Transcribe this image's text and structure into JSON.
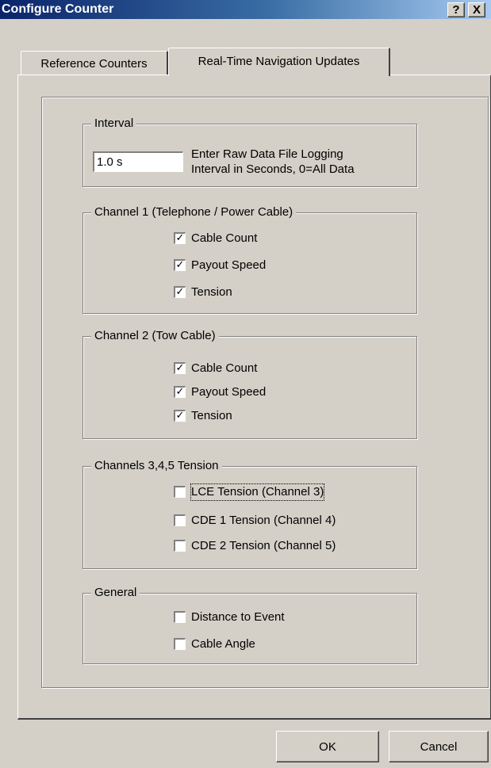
{
  "window": {
    "title": "Configure Counter",
    "help_label": "?",
    "close_label": "X"
  },
  "tabs": [
    {
      "label": "Reference Counters",
      "active": false
    },
    {
      "label": "Real-Time Navigation Updates",
      "active": true
    }
  ],
  "interval": {
    "title": "Interval",
    "value": "1.0 s",
    "hint_line1": "Enter Raw Data File Logging",
    "hint_line2": "Interval in Seconds, 0=All Data"
  },
  "channel1": {
    "title": "Channel 1  (Telephone / Power Cable)",
    "items": [
      {
        "label": "Cable Count",
        "checked": true
      },
      {
        "label": "Payout Speed",
        "checked": true
      },
      {
        "label": "Tension",
        "checked": true
      }
    ]
  },
  "channel2": {
    "title": "Channel 2  (Tow Cable)",
    "items": [
      {
        "label": "Cable Count",
        "checked": true
      },
      {
        "label": "Payout Speed",
        "checked": true
      },
      {
        "label": "Tension",
        "checked": true
      }
    ]
  },
  "channels345": {
    "title": "Channels 3,4,5 Tension",
    "items": [
      {
        "label": "LCE Tension (Channel 3)",
        "checked": false
      },
      {
        "label": "CDE 1 Tension (Channel 4)",
        "checked": false
      },
      {
        "label": "CDE 2 Tension (Channel 5)",
        "checked": false
      }
    ]
  },
  "general": {
    "title": "General",
    "items": [
      {
        "label": "Distance to Event",
        "checked": false
      },
      {
        "label": "Cable Angle",
        "checked": false
      }
    ]
  },
  "buttons": {
    "ok": "OK",
    "cancel": "Cancel"
  }
}
